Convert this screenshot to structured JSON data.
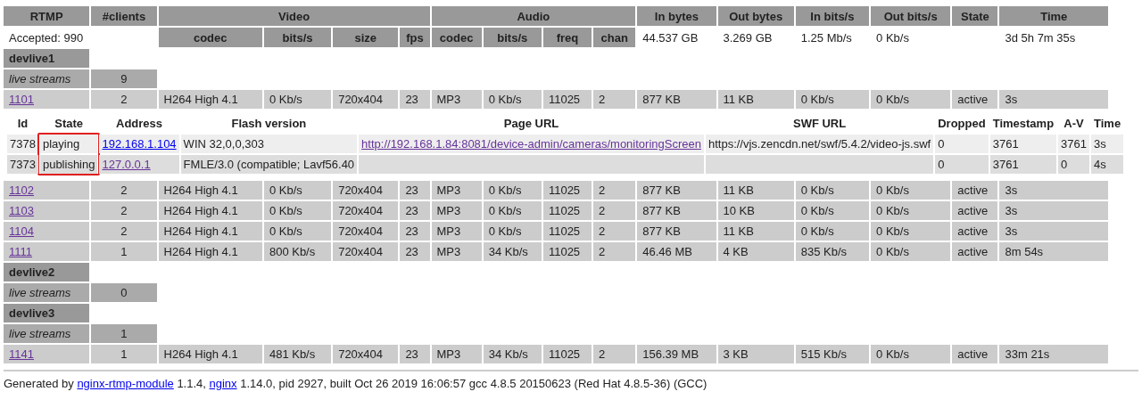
{
  "header": {
    "top": [
      {
        "label": "RTMP"
      },
      {
        "label": "#clients"
      },
      {
        "label": "Video",
        "children": [
          "codec",
          "bits/s",
          "size",
          "fps"
        ]
      },
      {
        "label": "Audio",
        "children": [
          "codec",
          "bits/s",
          "freq",
          "chan"
        ]
      },
      {
        "label": "In bytes"
      },
      {
        "label": "Out bytes"
      },
      {
        "label": "In bits/s"
      },
      {
        "label": "Out bits/s"
      },
      {
        "label": "State"
      },
      {
        "label": "Time"
      }
    ]
  },
  "summary": {
    "accepted": "Accepted: 990",
    "in_bytes": "44.537 GB",
    "out_bytes": "3.269 GB",
    "in_bits": "1.25 Mb/s",
    "out_bits": "0 Kb/s",
    "time": "3d 5h 7m 35s"
  },
  "applications": [
    {
      "name": "devlive1",
      "live_label": "live streams",
      "count": "9",
      "streams": [
        {
          "name": "1101",
          "visited": true,
          "cells": [
            "2",
            "H264 High 4.1",
            "0 Kb/s",
            "720x404",
            "23",
            "MP3",
            "0 Kb/s",
            "11025",
            "2",
            "877 KB",
            "11 KB",
            "0 Kb/s",
            "0 Kb/s",
            "active",
            "3s"
          ],
          "clients": {
            "columns": [
              "Id",
              "State",
              "Address",
              "Flash version",
              "Page URL",
              "SWF URL",
              "Dropped",
              "Timestamp",
              "A-V",
              "Time"
            ],
            "rows": [
              {
                "id": "7378",
                "state": "playing",
                "address": "192.168.1.104",
                "address_visited": false,
                "flash": "WIN 32,0,0,303",
                "page_url": "http://192.168.1.84:8081/device-admin/cameras/monitoringScreen",
                "page_url_visited": true,
                "swf_url": "https://vjs.zencdn.net/swf/5.4.2/video-js.swf",
                "dropped": "0",
                "timestamp": "3761",
                "av": "3761",
                "time": "3s",
                "publishing": false,
                "highlighted": true
              },
              {
                "id": "7373",
                "state": "publishing",
                "address": "127.0.0.1",
                "address_visited": true,
                "flash": "FMLE/3.0 (compatible; Lavf56.40",
                "dropped": "0",
                "timestamp": "3761",
                "av": "0",
                "time": "4s",
                "publishing": true,
                "highlighted": true
              }
            ]
          }
        },
        {
          "name": "1102",
          "visited": true,
          "cells": [
            "2",
            "H264 High 4.1",
            "0 Kb/s",
            "720x404",
            "23",
            "MP3",
            "0 Kb/s",
            "11025",
            "2",
            "877 KB",
            "11 KB",
            "0 Kb/s",
            "0 Kb/s",
            "active",
            "3s"
          ]
        },
        {
          "name": "1103",
          "visited": true,
          "cells": [
            "2",
            "H264 High 4.1",
            "0 Kb/s",
            "720x404",
            "23",
            "MP3",
            "0 Kb/s",
            "11025",
            "2",
            "877 KB",
            "10 KB",
            "0 Kb/s",
            "0 Kb/s",
            "active",
            "3s"
          ]
        },
        {
          "name": "1104",
          "visited": true,
          "cells": [
            "2",
            "H264 High 4.1",
            "0 Kb/s",
            "720x404",
            "23",
            "MP3",
            "0 Kb/s",
            "11025",
            "2",
            "877 KB",
            "11 KB",
            "0 Kb/s",
            "0 Kb/s",
            "active",
            "3s"
          ]
        },
        {
          "name": "1111",
          "visited": true,
          "cells": [
            "1",
            "H264 High 4.1",
            "800 Kb/s",
            "720x404",
            "23",
            "MP3",
            "34 Kb/s",
            "11025",
            "2",
            "46.46 MB",
            "4 KB",
            "835 Kb/s",
            "0 Kb/s",
            "active",
            "8m 54s"
          ]
        }
      ]
    },
    {
      "name": "devlive2",
      "live_label": "live streams",
      "count": "0"
    },
    {
      "name": "devlive3",
      "live_label": "live streams",
      "count": "1",
      "streams": [
        {
          "name": "1141",
          "visited": true,
          "cells": [
            "1",
            "H264 High 4.1",
            "481 Kb/s",
            "720x404",
            "23",
            "MP3",
            "34 Kb/s",
            "11025",
            "2",
            "156.39 MB",
            "3 KB",
            "515 Kb/s",
            "0 Kb/s",
            "active",
            "33m 21s"
          ]
        }
      ]
    }
  ],
  "footer": [
    {
      "text": "Generated by "
    },
    {
      "link": "nginx-rtmp-module",
      "visited": false
    },
    {
      "text": " 1.1.4, "
    },
    {
      "link": "nginx",
      "visited": false
    },
    {
      "text": " 1.14.0, pid 2927, built Oct 26 2019 16:06:57 gcc 4.8.5 20150623 (Red Hat 4.8.5-36) (GCC)"
    }
  ]
}
